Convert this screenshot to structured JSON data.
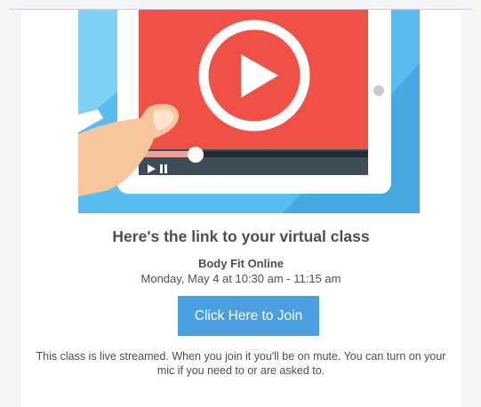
{
  "email": {
    "hero_image": "video-tablet-illustration",
    "headline": "Here's the link to your virtual class",
    "class_name": "Body Fit Online",
    "class_time": "Monday, May 4 at 10:30 am - 11:15 am",
    "join_label": "Click Here to Join",
    "note": "This class is live streamed. When you join it you'll be on mute. You can turn on your mic if you need to or are asked to."
  },
  "colors": {
    "hero_background": "#5bbcef",
    "video_red": "#ef5146",
    "join_button": "#4a9fe0",
    "text": "#4a4f57"
  }
}
